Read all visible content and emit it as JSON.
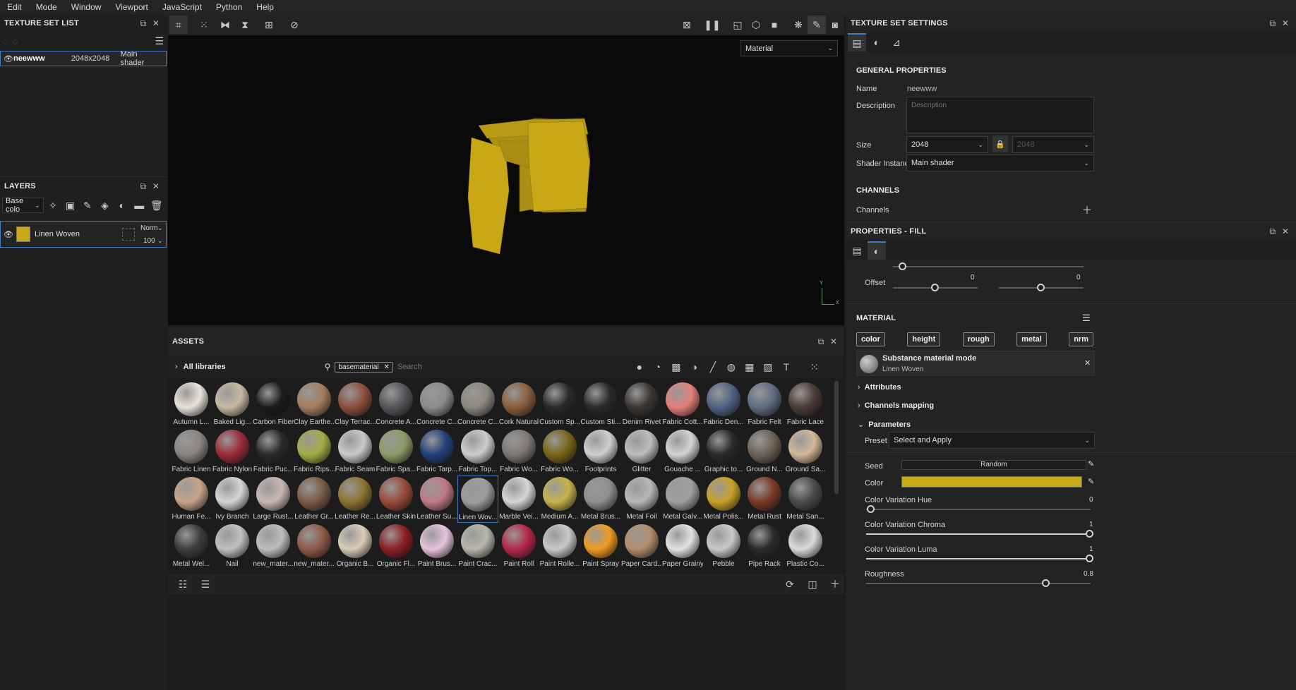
{
  "menu": [
    "Edit",
    "Mode",
    "Window",
    "Viewport",
    "JavaScript",
    "Python",
    "Help"
  ],
  "texture_set_list": {
    "title": "TEXTURE SET LIST",
    "row": {
      "name": "neewww",
      "size": "2048x2048",
      "shader": "Main shader"
    }
  },
  "layers": {
    "title": "LAYERS",
    "channel_select": "Base colo",
    "layer": {
      "name": "Linen Woven",
      "blend": "Norm",
      "opacity": "100",
      "color": "#c7a81a"
    }
  },
  "viewport": {
    "mode": "Material",
    "axis_y": "Y",
    "axis_x": "X",
    "object_color": "#c9a717"
  },
  "assets": {
    "title": "ASSETS",
    "library": "All libraries",
    "filter_tag": "basematerial",
    "search_placeholder": "Search",
    "rows": [
      [
        {
          "label": "Autumn L...",
          "color": "#e8e2da"
        },
        {
          "label": "Baked Lig...",
          "color": "#c8b9a1"
        },
        {
          "label": "Carbon Fiber",
          "color": "#1b1b1b"
        },
        {
          "label": "Clay Earthe...",
          "color": "#a47d5e"
        },
        {
          "label": "Clay Terrac...",
          "color": "#8d4f3b"
        },
        {
          "label": "Concrete A...",
          "color": "#55565a"
        },
        {
          "label": "Concrete C...",
          "color": "#8c8c8c"
        },
        {
          "label": "Concrete C...",
          "color": "#8b887f"
        },
        {
          "label": "Cork Natural",
          "color": "#8a5e3d"
        },
        {
          "label": "Custom Sp...",
          "color": "#2a2a2a"
        },
        {
          "label": "Custom Sti...",
          "color": "#2a2a2a"
        },
        {
          "label": "Denim Rivet",
          "color": "#3a3532"
        },
        {
          "label": "Fabric Cott...",
          "color": "#e57f78"
        },
        {
          "label": "Fabric Den...",
          "color": "#4f6283"
        },
        {
          "label": "Fabric Felt",
          "color": "#5e6c82"
        },
        {
          "label": "Fabric Lace",
          "color": "#4a3b36"
        }
      ],
      [
        {
          "label": "Fabric Linen",
          "color": "#8b8580"
        },
        {
          "label": "Fabric Nylon",
          "color": "#9b2c38"
        },
        {
          "label": "Fabric Puc...",
          "color": "#2a2a2a"
        },
        {
          "label": "Fabric Rips...",
          "color": "#a4ad43"
        },
        {
          "label": "Fabric Seam",
          "color": "#c9c9c9"
        },
        {
          "label": "Fabric Spa...",
          "color": "#8d9b67"
        },
        {
          "label": "Fabric Tarp...",
          "color": "#23407d"
        },
        {
          "label": "Fabric Top...",
          "color": "#cdcdcd"
        },
        {
          "label": "Fabric Wo...",
          "color": "#7e7873"
        },
        {
          "label": "Fabric Wo...",
          "color": "#7a6619"
        },
        {
          "label": "Footprints",
          "color": "#cfcfcf"
        },
        {
          "label": "Glitter",
          "color": "#bdbdbd"
        },
        {
          "label": "Gouache ...",
          "color": "#d3d3d3"
        },
        {
          "label": "Graphic to...",
          "color": "#2a2a2a"
        },
        {
          "label": "Ground N...",
          "color": "#6e6256"
        },
        {
          "label": "Ground Sa...",
          "color": "#d3b897"
        }
      ],
      [
        {
          "label": "Human Fe...",
          "color": "#c8a48a"
        },
        {
          "label": "Ivy Branch",
          "color": "#d5d5d5"
        },
        {
          "label": "Large Rust...",
          "color": "#c9b8b3"
        },
        {
          "label": "Leather Gr...",
          "color": "#7b5b45"
        },
        {
          "label": "Leather Re...",
          "color": "#8e7231"
        },
        {
          "label": "Leather Skin",
          "color": "#9a4a3a"
        },
        {
          "label": "Leather Su...",
          "color": "#c07a83"
        },
        {
          "label": "Linen Wov...",
          "color": "#9c9c9c"
        },
        {
          "label": "Marble Vei...",
          "color": "#d6d6d6"
        },
        {
          "label": "Medium A...",
          "color": "#c8b24a"
        },
        {
          "label": "Metal Brus...",
          "color": "#8f8f8f"
        },
        {
          "label": "Metal Foil",
          "color": "#b7b7b7"
        },
        {
          "label": "Metal Galv...",
          "color": "#a0a0a0"
        },
        {
          "label": "Metal Polis...",
          "color": "#c9a22b"
        },
        {
          "label": "Metal Rust",
          "color": "#7a3a24"
        },
        {
          "label": "Metal San...",
          "color": "#4b4b4b"
        }
      ],
      [
        {
          "label": "Metal Wel...",
          "color": "#3d3d3d"
        },
        {
          "label": "Nail",
          "color": "#bfbfbf"
        },
        {
          "label": "new_mater...",
          "color": "#bdbdbd"
        },
        {
          "label": "new_mater...",
          "color": "#8d5a47"
        },
        {
          "label": "Organic B...",
          "color": "#d9cbb6"
        },
        {
          "label": "Organic Fl...",
          "color": "#8e1e22"
        },
        {
          "label": "Paint Brus...",
          "color": "#e7c3dc"
        },
        {
          "label": "Paint Crac...",
          "color": "#b8b6ac"
        },
        {
          "label": "Paint Roll",
          "color": "#b7264a"
        },
        {
          "label": "Paint Rolle...",
          "color": "#c9c9c9"
        },
        {
          "label": "Paint Spray",
          "color": "#f19b1f"
        },
        {
          "label": "Paper Card...",
          "color": "#b38d6c"
        },
        {
          "label": "Paper Grainy",
          "color": "#e2e2e2"
        },
        {
          "label": "Pebble",
          "color": "#c9c9c9"
        },
        {
          "label": "Pipe Rack",
          "color": "#2a2a2a"
        },
        {
          "label": "Plastic Co...",
          "color": "#dadada"
        }
      ]
    ]
  },
  "texture_set_settings": {
    "title": "TEXTURE SET SETTINGS",
    "general": "GENERAL PROPERTIES",
    "name_label": "Name",
    "name_value": "neewww",
    "description_label": "Description",
    "description_placeholder": "Description",
    "size_label": "Size",
    "size_value": "2048",
    "size_value2": "2048",
    "shader_label": "Shader Instance",
    "shader_value": "Main shader",
    "channels_title": "CHANNELS",
    "channels_label": "Channels"
  },
  "properties_fill": {
    "title": "PROPERTIES - FILL",
    "offset_label": "Offset",
    "offset_x": "0",
    "offset_y": "0",
    "material_title": "MATERIAL",
    "chips": [
      "color",
      "height",
      "rough",
      "metal",
      "nrm"
    ],
    "mode_title": "Substance material mode",
    "mode_sub": "Linen Woven",
    "attributes": "Attributes",
    "channels_mapping": "Channels mapping",
    "parameters": "Parameters",
    "preset_label": "Preset",
    "preset_value": "Select and Apply",
    "seed_label": "Seed",
    "seed_value": "Random",
    "color_label": "Color",
    "color_value": "#c9a91a",
    "hue_label": "Color Variation Hue",
    "hue_value": "0",
    "chroma_label": "Color Variation Chroma",
    "chroma_value": "1",
    "luma_label": "Color Variation Luma",
    "luma_value": "1",
    "rough_label": "Roughness",
    "rough_value": "0.8"
  }
}
